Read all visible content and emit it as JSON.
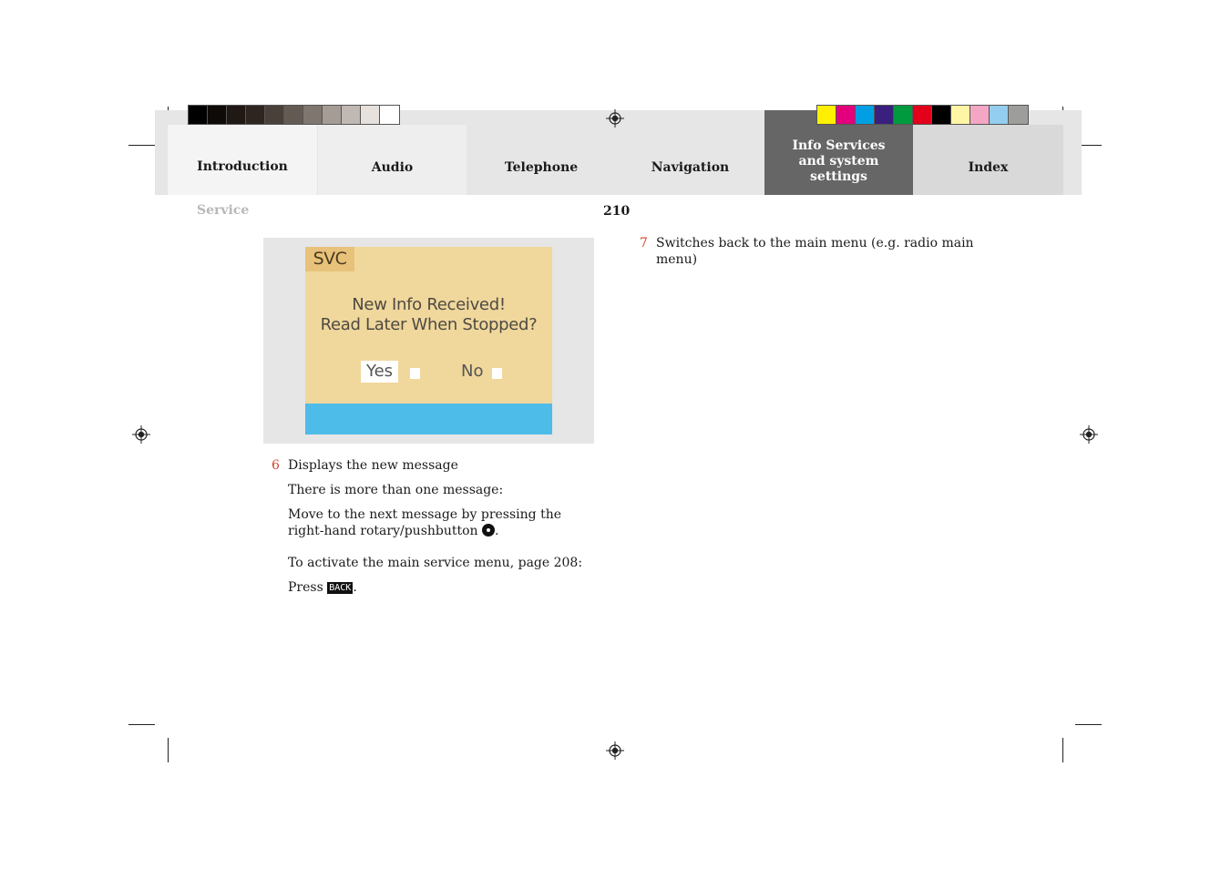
{
  "header": {
    "tabs": [
      {
        "label": "Introduction",
        "active": false
      },
      {
        "label": "Audio",
        "active": false
      },
      {
        "label": "Telephone",
        "active": false
      },
      {
        "label": "Navigation",
        "active": false
      },
      {
        "label": "Info Services and system settings",
        "active": true
      },
      {
        "label": "Index",
        "active": false
      }
    ],
    "section": "Service",
    "page_number": "210"
  },
  "colors": {
    "active_tab": "#666666",
    "tab_strip": "#e6e6e6",
    "item_number": "#d2452b",
    "screen_background": "#f0d79c",
    "screen_bar": "#4ebce8",
    "grayscale_bars": [
      "#000000",
      "#0e0a08",
      "#1f1814",
      "#2e2520",
      "#4a403a",
      "#645a54",
      "#7f7670",
      "#a59c96",
      "#c0b8b2",
      "#e6e1dd",
      "#ffffff"
    ],
    "process_bars": [
      "#ffef00",
      "#e4007d",
      "#009fe3",
      "#3a1f7e",
      "#009a3e",
      "#e2001a",
      "#000000",
      "#fff6a5",
      "#f4a7c4",
      "#93cdef",
      "#9d9d9c"
    ]
  },
  "screen": {
    "label": "SVC",
    "line1": "New Info Received!",
    "line2": "Read Later When Stopped?",
    "yes": "Yes",
    "no": "No"
  },
  "left_column": {
    "item6_number": "6",
    "item6_text": "Displays the new message",
    "para1": "There is more than one message:",
    "para2_line1": "Move to the next message by pressing the",
    "para2_line2": "right-hand rotary/pushbutton",
    "para2_icon": "rotary-pushbutton-icon",
    "para2_end": ".",
    "para3": "To activate the main service menu, page 208:",
    "para4_prefix": "Press",
    "para4_key": "BACK",
    "para4_end": "."
  },
  "right_column": {
    "item7_number": "7",
    "item7_line1": "Switches back to the main menu (e.g. radio main",
    "item7_line2": "menu)"
  }
}
